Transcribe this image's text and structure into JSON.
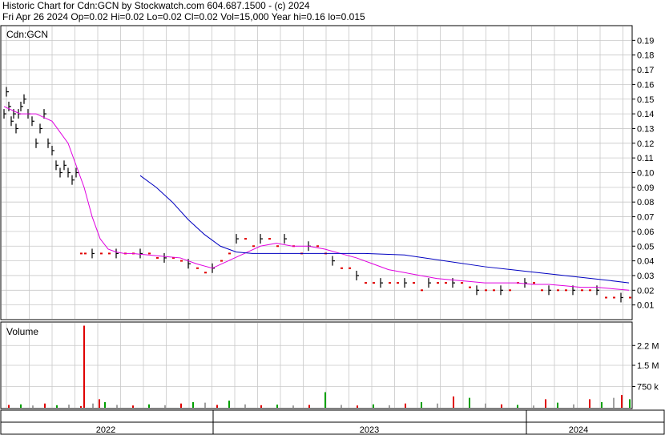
{
  "header": {
    "line1": "Historic Chart for Cdn:GCN by Stockwatch.com 604.687.1500 - (c) 2024",
    "line2": "Fri Apr 26 2024   Op=0.02  Hi=0.02  Lo=0.02  Cl=0.02  Vol=15,000  Year hi=0.16  lo=0.015"
  },
  "colors": {
    "ma_short": "#e000e0",
    "ma_long": "#0000c0",
    "volume_up": "#00a000",
    "volume_down": "#e00000",
    "volume_flat": "#a0a0a0",
    "price_bar": "#000000",
    "no_trade": "#e00000"
  },
  "chart_data": [
    {
      "type": "line",
      "title": "Cdn:GCN",
      "ylim": [
        0,
        0.2
      ],
      "yticks": [
        "0.19",
        "0.18",
        "0.17",
        "0.16",
        "0.15",
        "0.14",
        "0.13",
        "0.12",
        "0.11",
        "0.10",
        "0.09",
        "0.08",
        "0.07",
        "0.06",
        "0.05",
        "0.04",
        "0.03",
        "0.02",
        "0.01"
      ],
      "x_labels": [
        "2022",
        "2023",
        "2024"
      ],
      "grid": true,
      "series": [
        {
          "name": "",
          "kind": "price",
          "x": [
            0,
            3,
            6,
            9,
            12,
            15,
            18,
            21,
            25,
            30,
            35,
            40,
            45,
            50,
            55,
            60,
            65,
            70,
            75,
            80,
            85,
            90,
            95,
            100,
            110,
            120,
            130,
            140,
            150,
            160,
            170,
            180,
            190,
            200,
            210,
            220,
            230,
            240,
            250,
            260,
            270,
            280,
            290,
            300,
            310,
            320,
            330,
            340,
            350,
            360,
            370,
            380,
            390,
            400,
            410,
            420,
            430,
            440,
            450,
            460,
            470,
            480,
            490,
            500,
            510,
            520,
            530,
            540,
            550,
            560,
            570,
            580,
            590,
            600,
            610,
            620,
            630,
            640,
            650,
            660,
            670,
            680,
            690,
            700,
            710,
            720,
            730,
            740,
            750,
            760,
            770,
            780
          ],
          "y": [
            0.14,
            0.155,
            0.145,
            0.135,
            0.14,
            0.13,
            0.14,
            0.145,
            0.15,
            0.14,
            0.135,
            0.12,
            0.13,
            0.14,
            0.12,
            0.115,
            0.105,
            0.1,
            0.105,
            0.1,
            0.095,
            0.1,
            0.045,
            0.045,
            0.045,
            0.045,
            0.045,
            0.045,
            0.045,
            0.045,
            0.045,
            0.045,
            0.042,
            0.042,
            0.042,
            0.04,
            0.038,
            0.035,
            0.032,
            0.035,
            0.04,
            0.045,
            0.055,
            0.055,
            0.05,
            0.055,
            0.055,
            0.05,
            0.055,
            0.05,
            0.045,
            0.05,
            0.05,
            0.045,
            0.04,
            0.035,
            0.035,
            0.03,
            0.025,
            0.025,
            0.025,
            0.025,
            0.025,
            0.025,
            0.025,
            0.02,
            0.025,
            0.025,
            0.025,
            0.025,
            0.025,
            0.022,
            0.02,
            0.02,
            0.02,
            0.02,
            0.02,
            0.025,
            0.025,
            0.025,
            0.02,
            0.02,
            0.02,
            0.02,
            0.02,
            0.02,
            0.02,
            0.02,
            0.015,
            0.015,
            0.015,
            0.015
          ]
        },
        {
          "name": "",
          "kind": "ma_short",
          "x": [
            0,
            20,
            40,
            60,
            80,
            100,
            110,
            120,
            130,
            140,
            150,
            160,
            180,
            200,
            220,
            240,
            260,
            280,
            300,
            320,
            340,
            360,
            380,
            400,
            420,
            440,
            460,
            480,
            500,
            520,
            540,
            560,
            580,
            600,
            620,
            640,
            660,
            680,
            700,
            720,
            740,
            760,
            780
          ],
          "y": [
            0.145,
            0.14,
            0.14,
            0.135,
            0.12,
            0.09,
            0.07,
            0.055,
            0.048,
            0.046,
            0.045,
            0.045,
            0.044,
            0.043,
            0.042,
            0.038,
            0.035,
            0.04,
            0.045,
            0.05,
            0.052,
            0.05,
            0.05,
            0.048,
            0.045,
            0.042,
            0.038,
            0.034,
            0.032,
            0.03,
            0.028,
            0.027,
            0.026,
            0.025,
            0.025,
            0.025,
            0.024,
            0.024,
            0.023,
            0.022,
            0.022,
            0.021,
            0.02
          ]
        },
        {
          "name": "",
          "kind": "ma_long",
          "x": [
            170,
            190,
            210,
            230,
            250,
            270,
            290,
            310,
            330,
            350,
            370,
            390,
            410,
            450,
            500,
            550,
            600,
            650,
            700,
            750,
            780
          ],
          "y": [
            0.098,
            0.09,
            0.08,
            0.068,
            0.058,
            0.05,
            0.046,
            0.045,
            0.045,
            0.045,
            0.045,
            0.045,
            0.045,
            0.045,
            0.044,
            0.04,
            0.036,
            0.033,
            0.03,
            0.027,
            0.025
          ]
        }
      ]
    },
    {
      "type": "bar",
      "title": "Volume",
      "ylim": [
        0,
        3000000
      ],
      "yticks": [
        "2.2 M",
        "1.5 M",
        "750 k"
      ],
      "note_max": 2900000,
      "x": [
        5,
        20,
        35,
        50,
        65,
        80,
        95,
        99,
        110,
        118,
        125,
        140,
        160,
        180,
        200,
        220,
        235,
        250,
        265,
        280,
        300,
        320,
        340,
        360,
        380,
        400,
        420,
        440,
        460,
        480,
        500,
        520,
        540,
        560,
        580,
        600,
        620,
        640,
        660,
        675,
        690,
        710,
        730,
        745,
        760,
        770,
        780
      ],
      "values": [
        100000,
        120000,
        80000,
        150000,
        90000,
        110000,
        60000,
        2900000,
        150000,
        300000,
        200000,
        100000,
        80000,
        120000,
        90000,
        150000,
        200000,
        180000,
        100000,
        250000,
        120000,
        90000,
        110000,
        80000,
        100000,
        550000,
        100000,
        80000,
        120000,
        90000,
        150000,
        200000,
        150000,
        400000,
        350000,
        150000,
        120000,
        100000,
        80000,
        300000,
        180000,
        120000,
        300000,
        200000,
        350000,
        450000,
        300000
      ]
    }
  ]
}
